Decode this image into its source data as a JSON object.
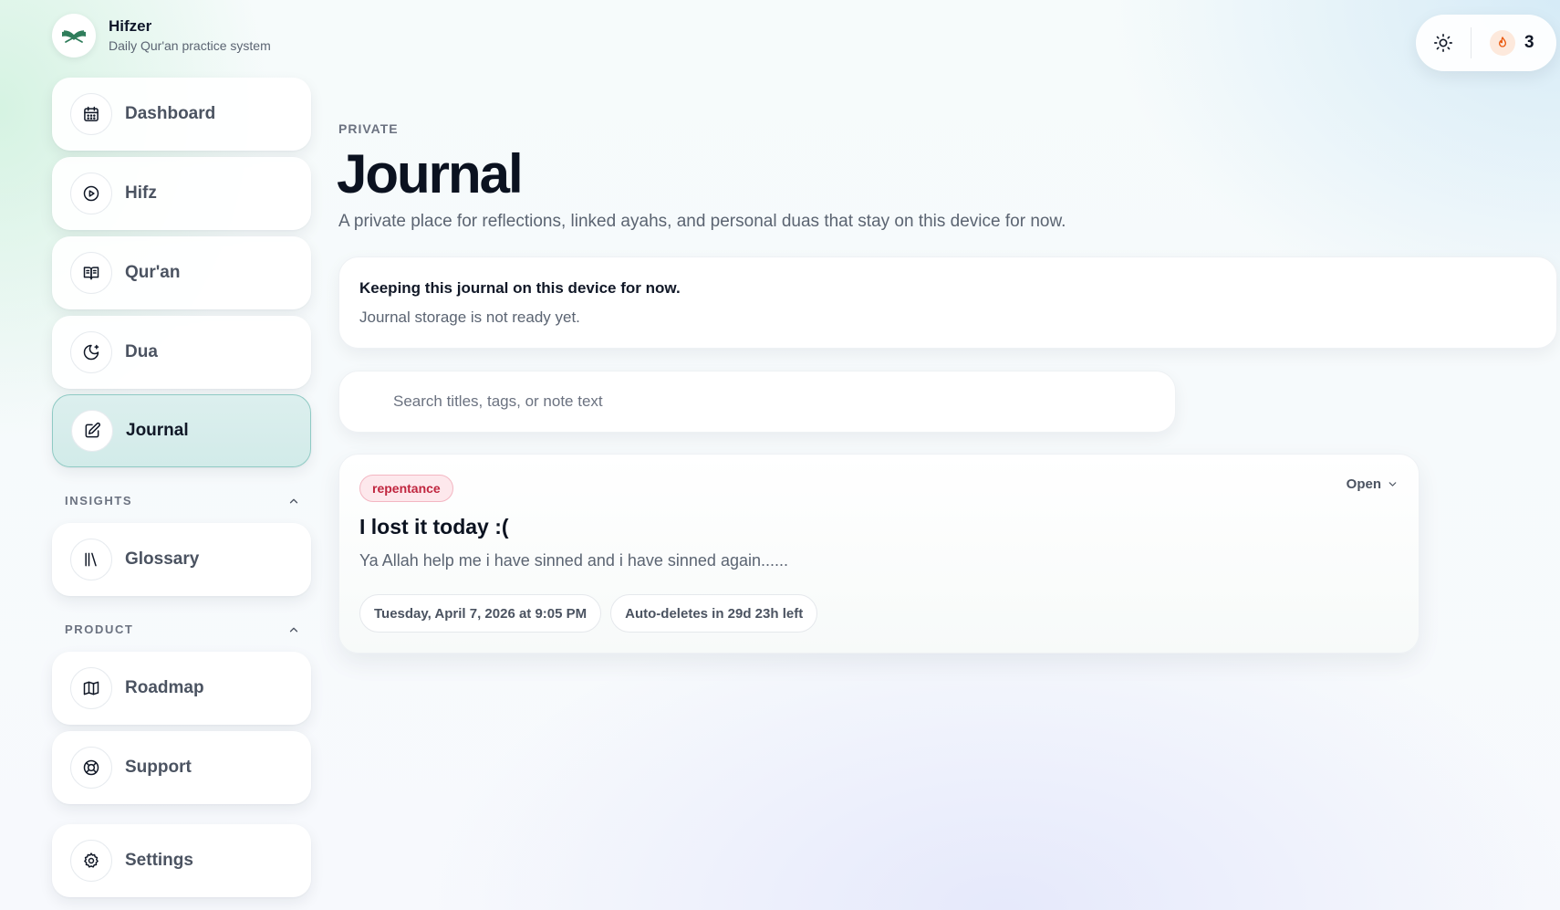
{
  "brand": {
    "name": "Hifzer",
    "tagline": "Daily Qur'an practice system"
  },
  "nav": {
    "items": [
      {
        "label": "Dashboard",
        "icon": "calendar-icon"
      },
      {
        "label": "Hifz",
        "icon": "play-circle-icon"
      },
      {
        "label": "Qur'an",
        "icon": "book-open-icon"
      },
      {
        "label": "Dua",
        "icon": "moon-star-icon"
      },
      {
        "label": "Journal",
        "icon": "edit-square-icon",
        "active": true
      }
    ],
    "insights": {
      "title": "INSIGHTS",
      "items": [
        {
          "label": "Glossary",
          "icon": "library-icon"
        }
      ]
    },
    "product": {
      "title": "PRODUCT",
      "items": [
        {
          "label": "Roadmap",
          "icon": "map-icon"
        },
        {
          "label": "Support",
          "icon": "life-buoy-icon"
        }
      ]
    },
    "settings": {
      "label": "Settings",
      "icon": "gear-icon"
    }
  },
  "topbar": {
    "theme_icon": "sun-icon",
    "streak_icon": "flame-icon",
    "streak_count": "3"
  },
  "page": {
    "eyebrow": "PRIVATE",
    "title": "Journal",
    "description": "A private place for reflections, linked ayahs, and personal duas that stay on this device for now."
  },
  "notice": {
    "title": "Keeping this journal on this device for now.",
    "body": "Journal storage is not ready yet."
  },
  "search": {
    "placeholder": "Search titles, tags, or note text",
    "value": ""
  },
  "entries": [
    {
      "tag": "repentance",
      "action": "Open",
      "title": "I lost it today :(",
      "body": "Ya Allah help me i have sinned and i have sinned again......",
      "date": "Tuesday, April 7, 2026 at 9:05 PM",
      "expiry": "Auto-deletes in 29d 23h left"
    }
  ],
  "colors": {
    "accent": "#8fcac4",
    "tag_text": "#c0263f",
    "tag_bg": "#fde8ec"
  }
}
